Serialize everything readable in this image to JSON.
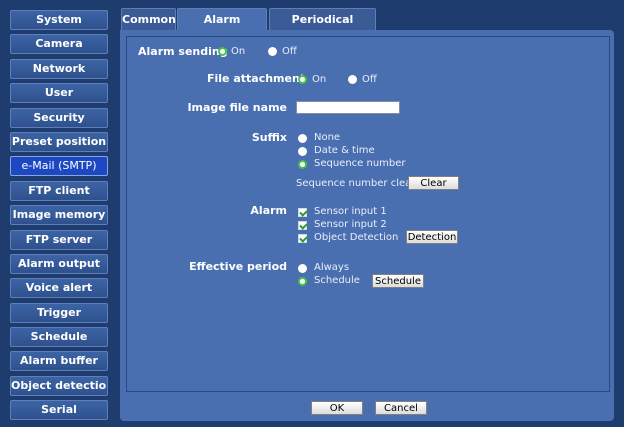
{
  "sidebar": {
    "items": [
      {
        "label": "System"
      },
      {
        "label": "Camera"
      },
      {
        "label": "Network"
      },
      {
        "label": "User"
      },
      {
        "label": "Security"
      },
      {
        "label": "Preset position"
      },
      {
        "label": "e-Mail (SMTP)",
        "active": true
      },
      {
        "label": "FTP client"
      },
      {
        "label": "Image memory"
      },
      {
        "label": "FTP server"
      },
      {
        "label": "Alarm output"
      },
      {
        "label": "Voice alert"
      },
      {
        "label": "Trigger"
      },
      {
        "label": "Schedule"
      },
      {
        "label": "Alarm buffer"
      },
      {
        "label": "Object detection"
      },
      {
        "label": "Serial"
      }
    ]
  },
  "tabs": {
    "common": "Common",
    "alarm_sending": "Alarm sending",
    "periodical_sending": "Periodical sending",
    "active": "alarm_sending"
  },
  "form": {
    "alarm_sending": {
      "label": "Alarm sending",
      "on": "On",
      "off": "Off",
      "value": "On"
    },
    "file_attachment": {
      "label": "File attachment",
      "on": "On",
      "off": "Off",
      "value": "On"
    },
    "image_file_name": {
      "label": "Image file name",
      "value": "",
      "placeholder": ""
    },
    "suffix": {
      "label": "Suffix",
      "options": [
        "None",
        "Date & time",
        "Sequence number"
      ],
      "value": "Sequence number",
      "sequence_clear_label": "Sequence number clear",
      "clear_button": "Clear"
    },
    "alarm": {
      "label": "Alarm",
      "options": [
        "Sensor input 1",
        "Sensor input 2",
        "Object Detection"
      ],
      "checked": [
        true,
        true,
        true
      ],
      "detection_button": "Detection"
    },
    "effective_period": {
      "label": "Effective period",
      "options": [
        "Always",
        "Schedule"
      ],
      "value": "Schedule",
      "schedule_button": "Schedule"
    }
  },
  "footer": {
    "ok": "OK",
    "cancel": "Cancel"
  },
  "colors": {
    "background": "#1f3c6e",
    "panel": "#4a6fb0",
    "active_nav": "#1d48c2",
    "radio_checked": "#47c447"
  }
}
